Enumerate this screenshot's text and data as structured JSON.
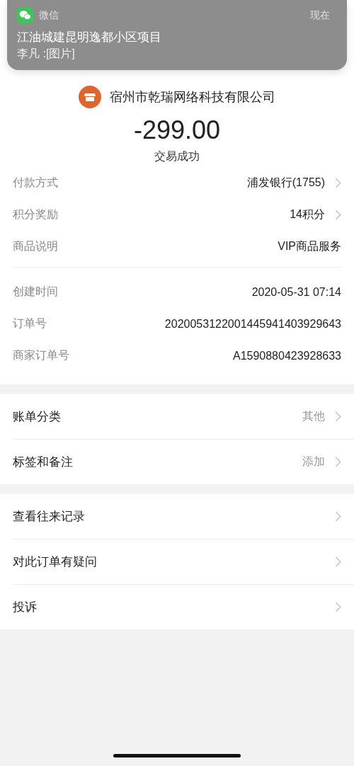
{
  "notification": {
    "app": "微信",
    "time": "现在",
    "title": "江油城建昆明逸都小区项目",
    "message": "李凡 :[图片]"
  },
  "merchant": {
    "name": "宿州市乾瑞网络科技有限公司",
    "amount": "-299.00",
    "status": "交易成功"
  },
  "detail_groups": [
    [
      {
        "label": "付款方式",
        "value": "浦发银行(1755)",
        "chevron": true
      },
      {
        "label": "积分奖励",
        "value": "14积分",
        "chevron": true
      },
      {
        "label": "商品说明",
        "value": "VIP商品服务",
        "chevron": false
      }
    ],
    [
      {
        "label": "创建时间",
        "value": "2020-05-31 07:14",
        "chevron": false
      },
      {
        "label": "订单号",
        "value": "2020053122001445941403929643",
        "chevron": false
      },
      {
        "label": "商家订单号",
        "value": "A1590880423928633",
        "chevron": false
      }
    ]
  ],
  "menu_groups": [
    [
      {
        "label": "账单分类",
        "value": "其他"
      },
      {
        "label": "标签和备注",
        "value": "添加"
      }
    ],
    [
      {
        "label": "查看往来记录"
      },
      {
        "label": "对此订单有疑问"
      },
      {
        "label": "投诉"
      }
    ]
  ]
}
